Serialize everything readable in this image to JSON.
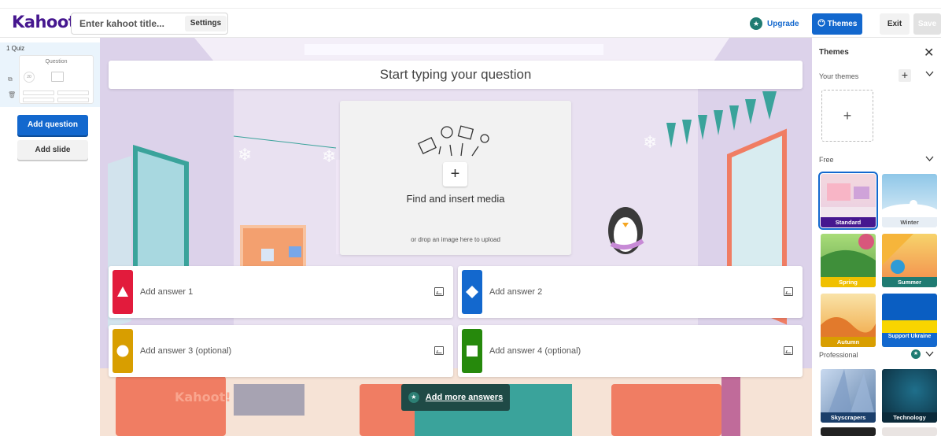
{
  "header": {
    "logo": "Kahoot!",
    "title_placeholder": "Enter kahoot title...",
    "settings_label": "Settings",
    "upgrade_label": "Upgrade",
    "themes_label": "Themes",
    "exit_label": "Exit",
    "save_label": "Save"
  },
  "sidebar": {
    "slide_number": "1 Quiz",
    "thumb_label": "Question",
    "thumb_timer": "20",
    "add_question_label": "Add question",
    "add_slide_label": "Add slide"
  },
  "editor": {
    "question_placeholder": "Start typing your question",
    "media_plus": "+",
    "media_title": "Find and insert media",
    "media_subtitle": "or drop an image here to upload",
    "answers": [
      {
        "placeholder": "Add answer 1",
        "color": "#e21b3c",
        "shape": "triangle-icon"
      },
      {
        "placeholder": "Add answer 2",
        "color": "#1368ce",
        "shape": "diamond-icon"
      },
      {
        "placeholder": "Add answer 3 (optional)",
        "color": "#d89e00",
        "shape": "circle-icon"
      },
      {
        "placeholder": "Add answer 4 (optional)",
        "color": "#26890c",
        "shape": "square-icon"
      }
    ],
    "add_more_answers_label": "Add more answers"
  },
  "themes_panel": {
    "title": "Themes",
    "close": "✕",
    "your_themes_label": "Your themes",
    "add_symbol": "+",
    "free_label": "Free",
    "professional_label": "Professional",
    "themes": [
      {
        "name": "Standard",
        "selected": true
      },
      {
        "name": "Winter",
        "selected": false
      },
      {
        "name": "Spring",
        "selected": false
      },
      {
        "name": "Summer",
        "selected": false
      },
      {
        "name": "Autumn",
        "selected": false
      },
      {
        "name": "Support Ukraine",
        "selected": false
      },
      {
        "name": "Skyscrapers",
        "selected": false
      },
      {
        "name": "Technology",
        "selected": false
      }
    ]
  },
  "colors": {
    "brand": "#46178f",
    "primary": "#1368ce",
    "premium": "#1f7b72"
  }
}
